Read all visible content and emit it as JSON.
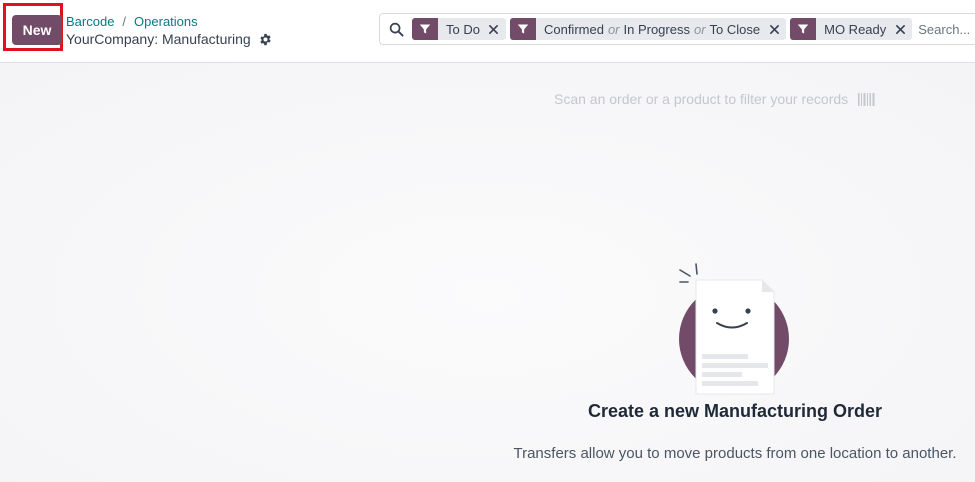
{
  "control_panel": {
    "new_button_label": "New",
    "breadcrumb": [
      {
        "label": "Barcode"
      },
      {
        "label": "Operations"
      }
    ],
    "breadcrumb_separator": "/",
    "page_title": "YourCompany: Manufacturing",
    "settings_icon": "gear-icon",
    "highlight_color": "#e0131d"
  },
  "search": {
    "icon": "search-icon",
    "placeholder": "Search...",
    "facets": [
      {
        "icon": "filter-icon",
        "values": [
          "To Do"
        ],
        "remove_icon": "close-icon"
      },
      {
        "icon": "filter-icon",
        "values": [
          "Confirmed",
          "In Progress",
          "To Close"
        ],
        "remove_icon": "close-icon"
      },
      {
        "icon": "filter-icon",
        "values": [
          "MO Ready"
        ],
        "remove_icon": "close-icon"
      }
    ],
    "facet_separator": "or"
  },
  "main": {
    "barcode_hint": "Scan an order or a product to filter your records",
    "barcode_icon": "barcode-icon",
    "helper_title": "Create a new Manufacturing Order",
    "helper_text": "Transfers allow you to move products from one location to another."
  },
  "colors": {
    "brand": "#714b67",
    "link": "#017e84",
    "facet_bg": "#e7e9ed",
    "content_bg": "#f9f9fa"
  }
}
